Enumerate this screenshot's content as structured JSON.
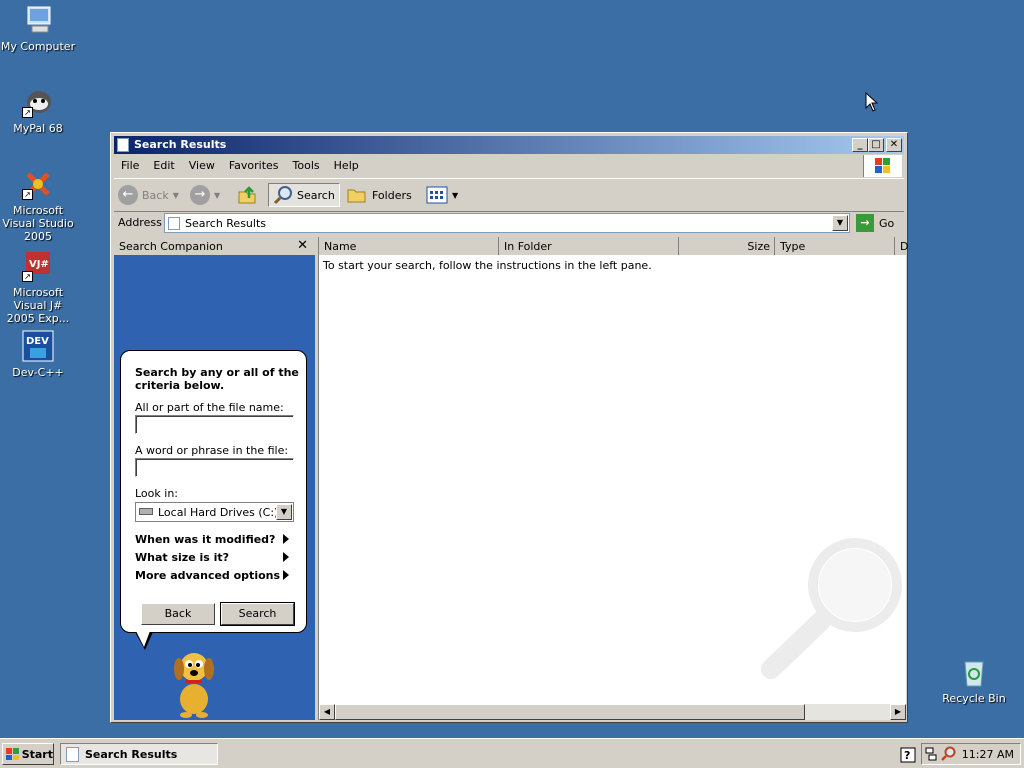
{
  "desktop": {
    "icons": [
      {
        "label": "My Computer"
      },
      {
        "label": "MyPal 68"
      },
      {
        "label": "Microsoft Visual Studio 2005"
      },
      {
        "label": "Microsoft Visual J# 2005 Exp..."
      },
      {
        "label": "Dev-C++"
      },
      {
        "label": "Recycle Bin"
      }
    ]
  },
  "window": {
    "title": "Search Results",
    "menu": [
      "File",
      "Edit",
      "View",
      "Favorites",
      "Tools",
      "Help"
    ],
    "toolbar": {
      "back": "Back",
      "search": "Search",
      "folders": "Folders"
    },
    "address": {
      "label": "Address",
      "value": "Search Results",
      "go": "Go"
    },
    "companion": {
      "title": "Search Companion",
      "close": "✕",
      "heading": "Search by any or all of the criteria below.",
      "filename_label": "All or part of the file name:",
      "filename_value": "",
      "phrase_label": "A word or phrase in the file:",
      "phrase_value": "",
      "lookin_label": "Look in:",
      "lookin_value": "Local Hard Drives (C:)",
      "options": [
        "When was it modified?",
        "What size is it?",
        "More advanced options"
      ],
      "back_button": "Back",
      "search_button": "Search"
    },
    "results": {
      "columns": [
        "Name",
        "In Folder",
        "Size",
        "Type",
        "D"
      ],
      "message": "To start your search, follow the instructions in the left pane."
    }
  },
  "taskbar": {
    "start": "Start",
    "task": "Search Results",
    "time": "11:27 AM"
  },
  "colors": {
    "desktop": "#3a6ea5",
    "titlebar": "#0a246a",
    "companion_bg": "#2f62b1"
  }
}
